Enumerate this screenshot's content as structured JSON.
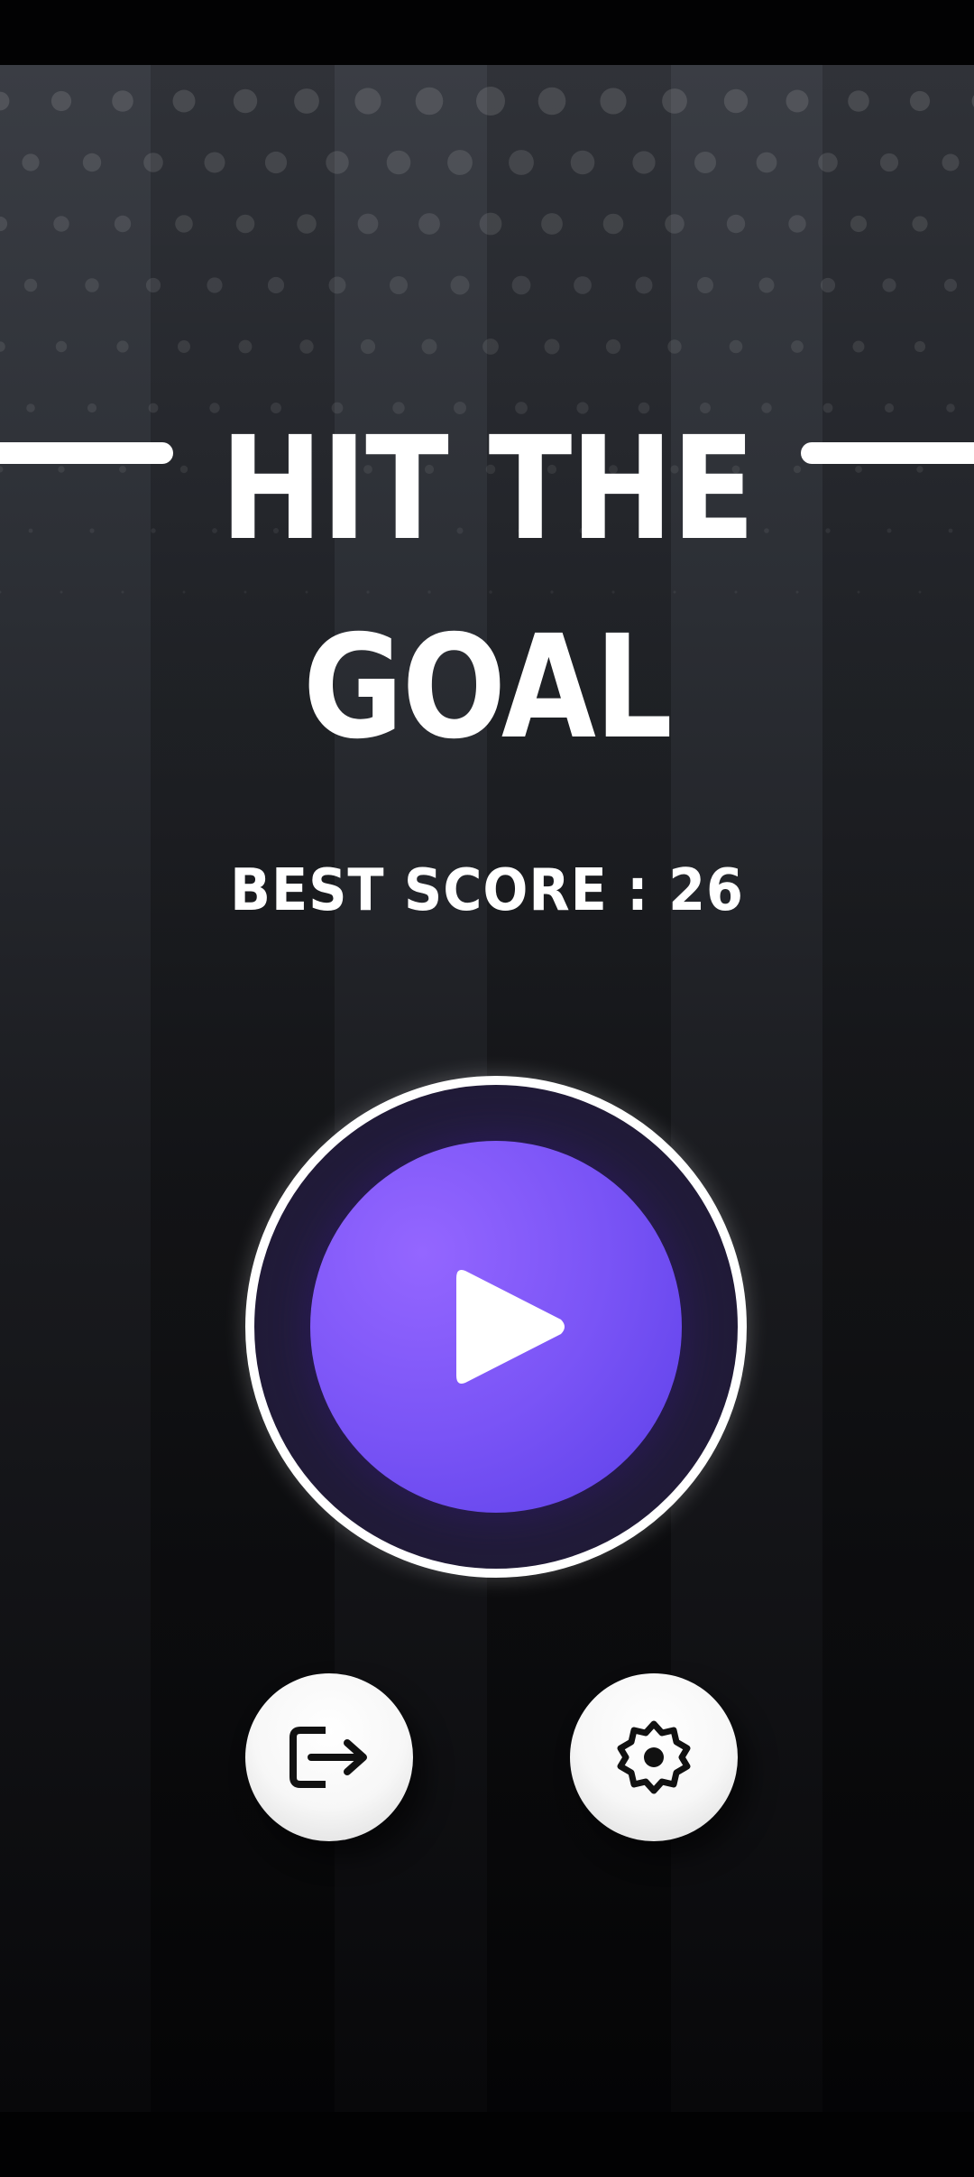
{
  "title": {
    "line1": "Hit the",
    "line2": "Goal"
  },
  "best_score": {
    "text": "BEST SCORE : 26",
    "value": 26
  },
  "buttons": {
    "play": "play-icon",
    "exit": "exit-icon",
    "settings": "gear-icon"
  },
  "colors": {
    "play_button": "#7a54f6",
    "background_top": "#3a3d44",
    "background_bottom": "#08080a",
    "text": "#ffffff"
  }
}
